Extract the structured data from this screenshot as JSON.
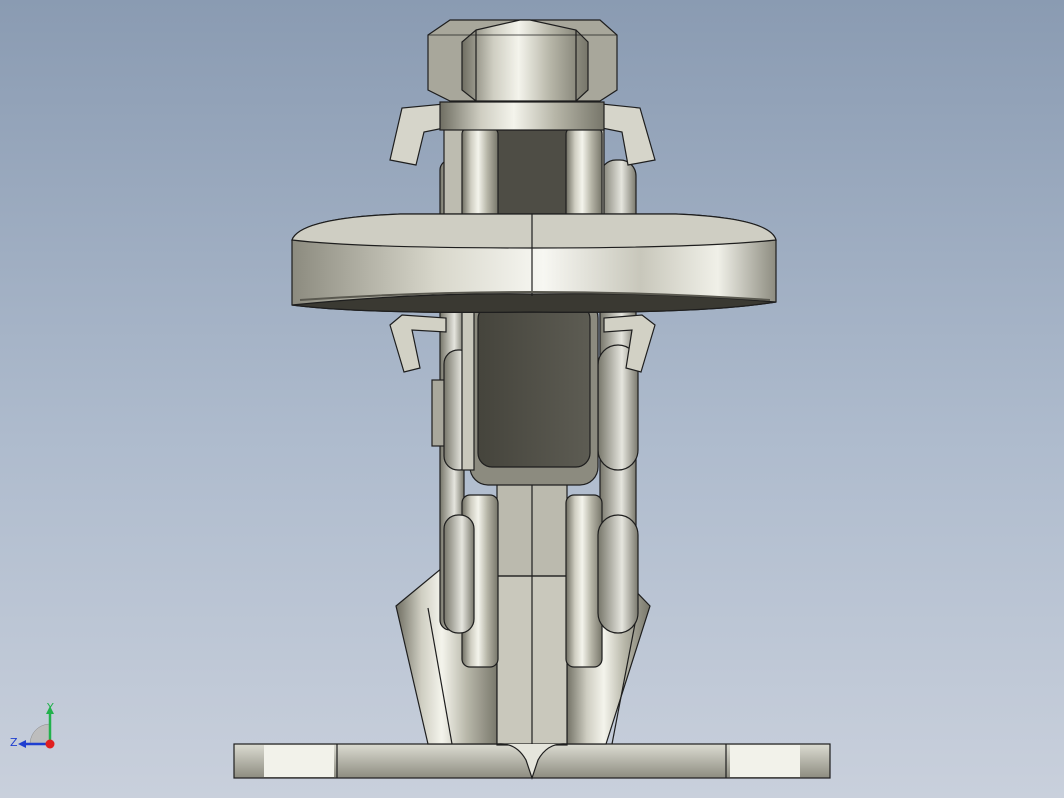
{
  "viewport": {
    "background_top": "#8a9bb2",
    "background_bottom": "#c9d0dc",
    "model_color": "#bdbcae",
    "edge_color": "#1e1e1e"
  },
  "triad": {
    "x_label": "",
    "y_label": "Y",
    "z_label": "Z",
    "y_color": "#22b14c",
    "z_color": "#1f3fd0",
    "x_color": "#e01f1f"
  }
}
